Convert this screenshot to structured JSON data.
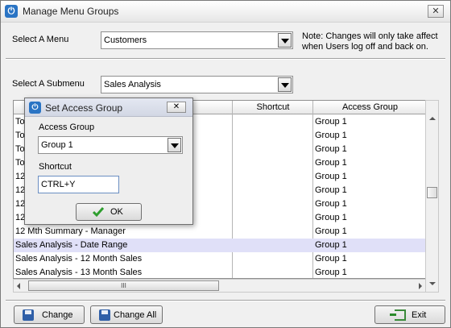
{
  "window": {
    "title": "Manage Menu Groups",
    "close": "✕"
  },
  "menu_select": {
    "label": "Select A Menu",
    "value": "Customers"
  },
  "note": "Note: Changes will only take affect when Users log off and back on.",
  "submenu_select": {
    "label": "Select A Submenu",
    "value": "Sales Analysis"
  },
  "grid": {
    "headers": {
      "shortcut": "Shortcut",
      "access_group": "Access Group"
    },
    "rows": [
      {
        "name": "To",
        "shortcut": "",
        "group": "Group 1"
      },
      {
        "name": "To",
        "shortcut": "",
        "group": "Group 1"
      },
      {
        "name": "To",
        "shortcut": "",
        "group": "Group 1"
      },
      {
        "name": "To",
        "shortcut": "",
        "group": "Group 1"
      },
      {
        "name": "12",
        "shortcut": "",
        "group": "Group 1"
      },
      {
        "name": "12",
        "shortcut": "",
        "group": "Group 1"
      },
      {
        "name": "12",
        "shortcut": "",
        "group": "Group 1"
      },
      {
        "name": "12",
        "shortcut": "",
        "group": "Group 1"
      },
      {
        "name": "12 Mth Summary - Manager",
        "shortcut": "",
        "group": "Group 1"
      },
      {
        "name": "Sales Analysis - Date Range",
        "shortcut": "",
        "group": "Group 1"
      },
      {
        "name": "Sales Analysis - 12 Month Sales",
        "shortcut": "",
        "group": "Group 1"
      },
      {
        "name": "Sales Analysis - 13 Month Sales",
        "shortcut": "",
        "group": "Group 1"
      }
    ],
    "selected_row": 9,
    "hscroll_grip": "III"
  },
  "buttons": {
    "change": "Change",
    "change_all": "Change All",
    "exit": "Exit"
  },
  "dialog": {
    "title": "Set Access Group",
    "close": "✕",
    "access_group_label": "Access Group",
    "access_group_value": "Group 1",
    "shortcut_label": "Shortcut",
    "shortcut_value": "CTRL+Y",
    "ok": "OK"
  },
  "colors": {
    "selected_row": "#e0e0f8",
    "app_icon": "#2a74c4",
    "ok_check": "#2e9e2e"
  }
}
